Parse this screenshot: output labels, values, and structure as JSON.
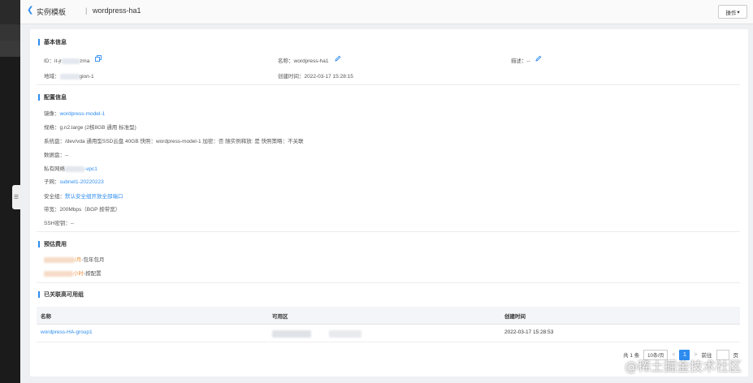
{
  "breadcrumb": {
    "back_icon": "chevron-left-icon",
    "parent": "实例模板",
    "separator": "|",
    "current": "wordpress-ha1"
  },
  "toolbar": {
    "action_label": "操作",
    "action_icon": "caret-down-icon"
  },
  "sidebar": {
    "collapse_label": "☰"
  },
  "basic": {
    "title": "基本信息",
    "id_label": "ID：",
    "id_prefix": "it-jr",
    "id_suffix": "zma",
    "name_label": "名称：",
    "name_value": "wordpress-ha1",
    "desc_label": "描述：",
    "desc_value": "--",
    "region_label": "地域：",
    "region_suffix": "gion-1",
    "created_label": "创建时间：",
    "created_value": "2022-03-17 15:28:15"
  },
  "config": {
    "title": "配置信息",
    "image_label": "镜像：",
    "image_value": "wordpress-model-1",
    "spec_label": "规格：",
    "spec_value": "g.n2.large (2核8GB 通用 标准型)",
    "sysdisk_label": "系统盘：",
    "sysdisk_value": "/dev/vda 通用型SSD云盘 40GB 快照：wordpress-model-1 加密：否 随实例释放: 是 快照策略：不关联",
    "datadisk_label": "数据盘：",
    "datadisk_value": "--",
    "vpc_label": "私有网络",
    "vpc_suffix": "-vpc1",
    "subnet_label": "子网：",
    "subnet_value": "subnet1-20220223",
    "sg_label": "安全组：",
    "sg_value": "默认安全组开放全部端口",
    "bw_label": "带宽：",
    "bw_value": "200Mbps（BGP 按带宽）",
    "ssh_label": "SSH密钥：",
    "ssh_value": "--"
  },
  "cost": {
    "title": "预估费用",
    "monthly_suffix": "/月",
    "monthly_note": "-包年包月",
    "hourly_suffix": "小时",
    "hourly_note": "-按配置"
  },
  "ha": {
    "title": "已关联高可用组",
    "columns": [
      "名称",
      "可用区",
      "创建时间"
    ],
    "rows": [
      {
        "name": "wordpress-HA-group1",
        "created": "2022-03-17 15:28:53"
      }
    ]
  },
  "pager": {
    "total": "共 1 条",
    "page_size": "10条/页",
    "current_page": "1",
    "goto_label": "前往",
    "page_unit": "页"
  },
  "watermark": "@稀土掘金技术社区",
  "colors": {
    "accent": "#2d8cf0",
    "page_bg": "#eef0f3",
    "sidebar": "#262626"
  }
}
